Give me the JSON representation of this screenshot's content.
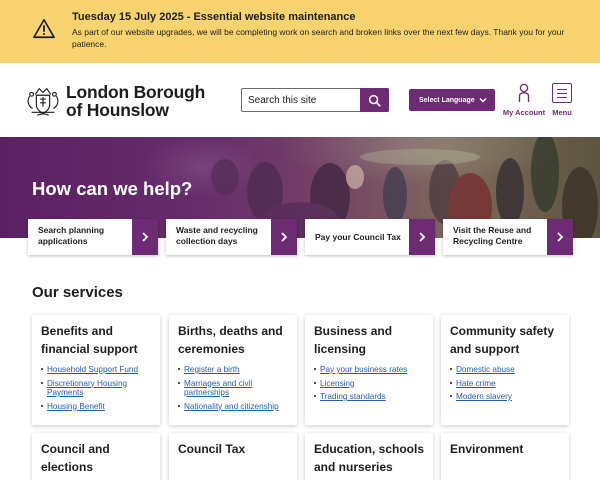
{
  "alert": {
    "title": "Tuesday 15 July 2025 - Essential website maintenance",
    "text": "As part of our website upgrades, we will be completing work on search and broken links over the next few days. Thank you for your patience."
  },
  "header": {
    "logo_line1": "London Borough",
    "logo_line2": "of Hounslow",
    "search_placeholder": "Search this site",
    "language_label": "Select Language",
    "account_label": "My Account",
    "menu_label": "Menu"
  },
  "hero": {
    "title": "How can we help?"
  },
  "quick_links": [
    {
      "label": "Search planning applications"
    },
    {
      "label": "Waste and recycling collection days"
    },
    {
      "label": "Pay your Council Tax"
    },
    {
      "label": "Visit the Reuse and Recycling Centre"
    }
  ],
  "services": {
    "title": "Our services",
    "cards": [
      {
        "title": "Benefits and financial support",
        "links": [
          "Household Support Fund",
          "Discretionary Housing Payments",
          "Housing Benefit"
        ]
      },
      {
        "title": "Births, deaths and ceremonies",
        "links": [
          "Register a birth",
          "Marriages and civil partnerships",
          "Nationality and citizenship"
        ]
      },
      {
        "title": "Business and licensing",
        "links": [
          "Pay your business rates",
          "Licensing",
          "Trading standards"
        ]
      },
      {
        "title": "Community safety and support",
        "links": [
          "Domestic abuse",
          "Hate crime",
          "Modern slavery"
        ]
      },
      {
        "title": "Council and elections",
        "links": []
      },
      {
        "title": "Council Tax",
        "links": []
      },
      {
        "title": "Education, schools and nurseries",
        "links": []
      },
      {
        "title": "Environment",
        "links": []
      }
    ]
  },
  "colors": {
    "brand_purple": "#6d2b73",
    "alert_yellow": "#f8d36f",
    "link_blue": "#1f5fb0"
  }
}
